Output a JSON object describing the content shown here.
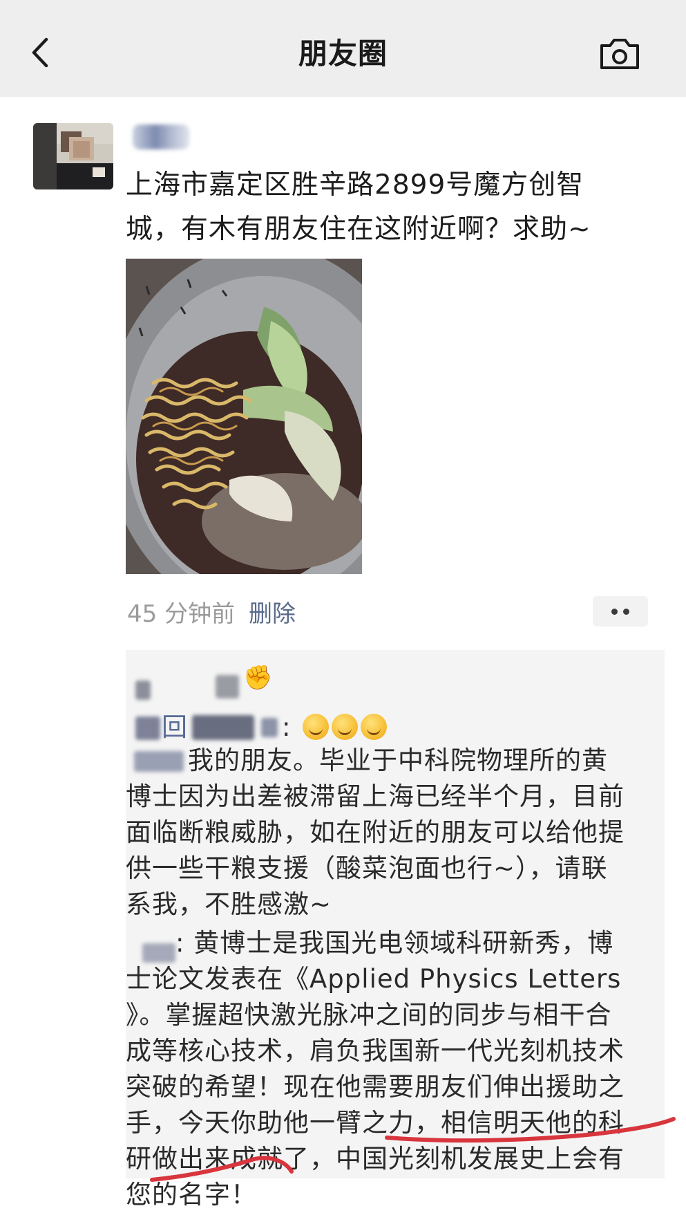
{
  "nav": {
    "title": "朋友圈"
  },
  "post": {
    "text_lines": [
      "上海市嘉定区胜辛路2899号魔方创智",
      "城，有木有朋友住在这附近啊？求助~"
    ],
    "time": "45 分钟前",
    "delete_label": "删除"
  },
  "comments": {
    "reaction_emoji": "✊",
    "reply_word": "回",
    "reply_sep": ":",
    "comment2_lines": [
      "我的朋友。毕业于中科院物理所的黄",
      "博士因为出差被滞留上海已经半个月，目前",
      "面临断粮威胁，如在附近的朋友可以给他提",
      "供一些干粮支援（酸菜泡面也行~），请联",
      "系我，不胜感激~"
    ],
    "comment3_prefix": ":",
    "comment3_lines": [
      "黄博士是我国光电领域科研新秀，博",
      "士论文发表在《Applied Physics Letters",
      "》。掌握超快激光脉冲之间的同步与相干合",
      "成等核心技术，肩负我国新一代光刻机技术",
      "突破的希望！现在他需要朋友们伸出援助之",
      "手，今天你助他一臂之力，相信明天他的科",
      "研做出来成就了，中国光刻机发展史上会有",
      "您的名字！"
    ]
  },
  "colors": {
    "nav_bg": "#eeeeee",
    "link": "#576b95",
    "annotation": "#d8353d"
  },
  "icons": [
    "back-arrow-icon",
    "camera-icon",
    "more-dots-icon",
    "laugh-cry-emoji"
  ]
}
